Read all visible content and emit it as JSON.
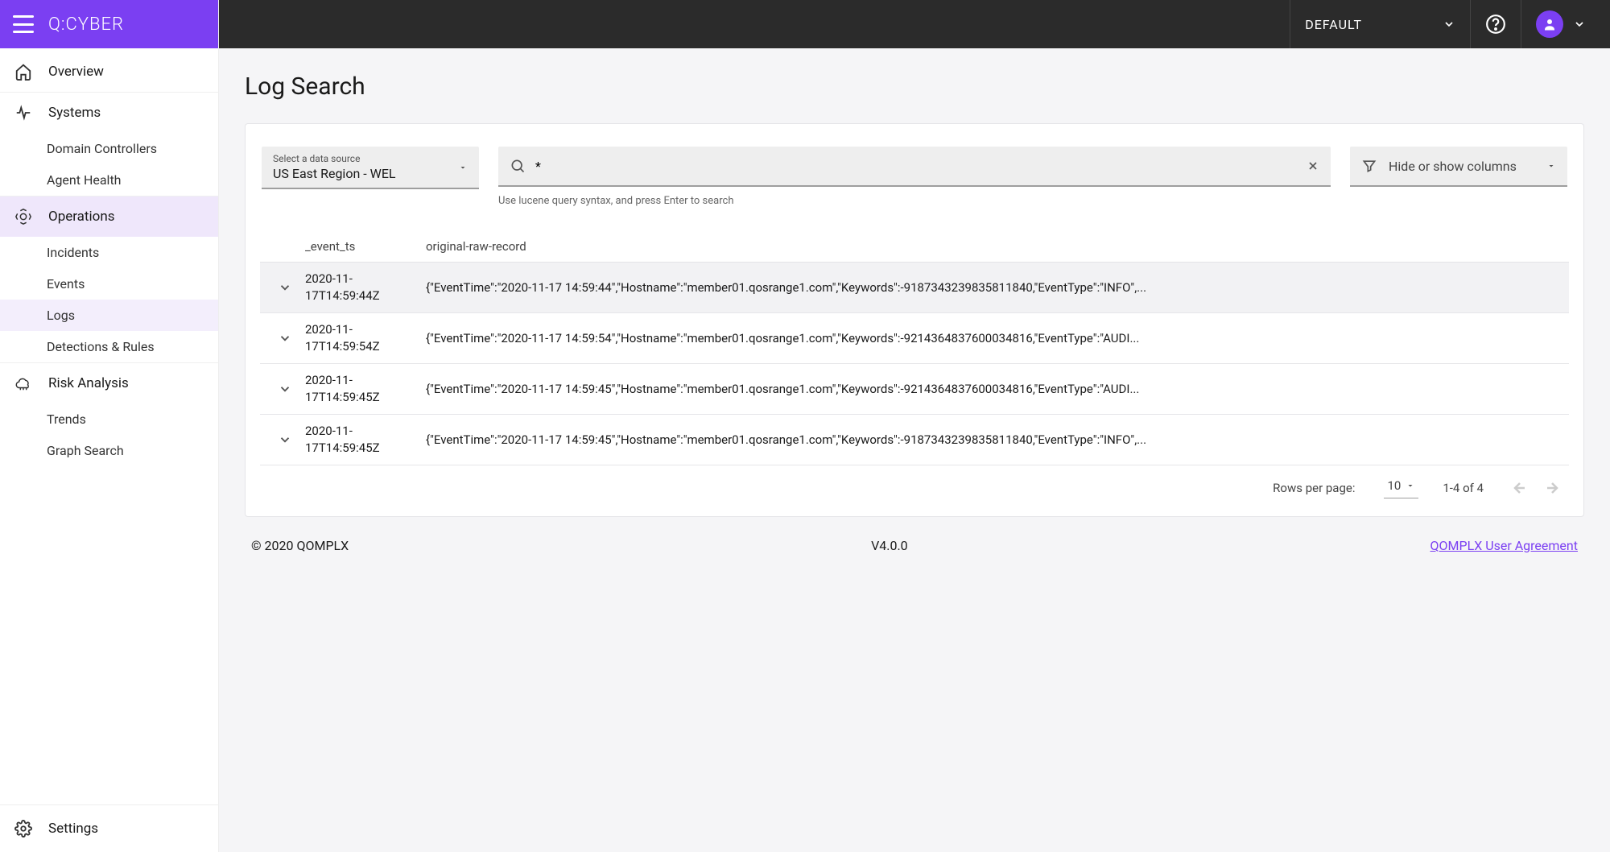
{
  "brand": {
    "name": "Q:CYBER"
  },
  "topbar": {
    "dropdown_label": "DEFAULT"
  },
  "sidebar": {
    "items": [
      {
        "label": "Overview",
        "icon": "home"
      },
      {
        "label": "Systems",
        "icon": "activity",
        "children": [
          {
            "label": "Domain Controllers"
          },
          {
            "label": "Agent Health"
          }
        ]
      },
      {
        "label": "Operations",
        "icon": "alert",
        "children": [
          {
            "label": "Incidents"
          },
          {
            "label": "Events"
          },
          {
            "label": "Logs",
            "active": true
          },
          {
            "label": "Detections & Rules"
          }
        ]
      },
      {
        "label": "Risk Analysis",
        "icon": "cloud",
        "children": [
          {
            "label": "Trends"
          },
          {
            "label": "Graph Search"
          }
        ]
      }
    ],
    "settings_label": "Settings"
  },
  "page": {
    "title": "Log Search",
    "datasource": {
      "label": "Select a data source",
      "value": "US East Region - WEL"
    },
    "search": {
      "value": "*",
      "hint": "Use lucene query syntax, and press Enter to search"
    },
    "columns_toggle": "Hide or show columns",
    "table": {
      "headers": {
        "ts": "_event_ts",
        "raw": "original-raw-record"
      },
      "rows": [
        {
          "ts": "2020-11-17T14:59:44Z",
          "raw": "{\"EventTime\":\"2020-11-17 14:59:44\",\"Hostname\":\"member01.qosrange1.com\",\"Keywords\":-9187343239835811840,\"EventType\":\"INFO\",..."
        },
        {
          "ts": "2020-11-17T14:59:54Z",
          "raw": "{\"EventTime\":\"2020-11-17 14:59:54\",\"Hostname\":\"member01.qosrange1.com\",\"Keywords\":-9214364837600034816,\"EventType\":\"AUDI..."
        },
        {
          "ts": "2020-11-17T14:59:45Z",
          "raw": "{\"EventTime\":\"2020-11-17 14:59:45\",\"Hostname\":\"member01.qosrange1.com\",\"Keywords\":-9214364837600034816,\"EventType\":\"AUDI..."
        },
        {
          "ts": "2020-11-17T14:59:45Z",
          "raw": "{\"EventTime\":\"2020-11-17 14:59:45\",\"Hostname\":\"member01.qosrange1.com\",\"Keywords\":-9187343239835811840,\"EventType\":\"INFO\",..."
        }
      ]
    },
    "pagination": {
      "rpp_label": "Rows per page:",
      "rpp_value": "10",
      "range": "1-4 of 4"
    }
  },
  "footer": {
    "copyright": "© 2020 QOMPLX",
    "version": "V4.0.0",
    "link": "QOMPLX User Agreement"
  }
}
